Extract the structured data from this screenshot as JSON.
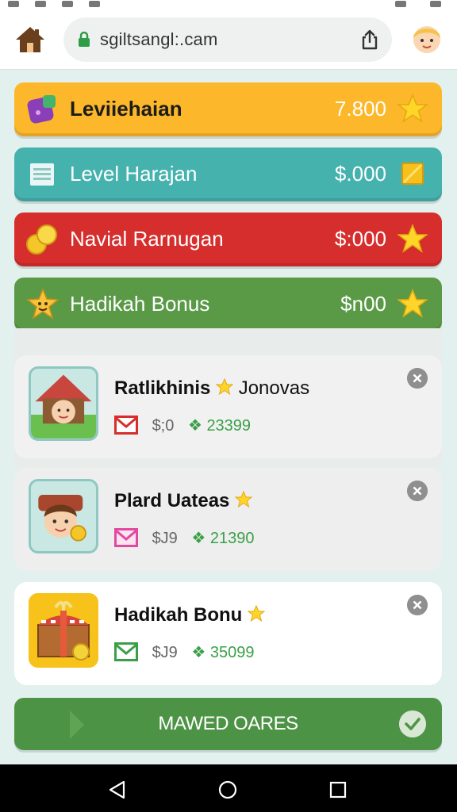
{
  "browser": {
    "url": "sgiltsangl:.cam",
    "home_icon": "home-icon",
    "lock_icon": "lock-icon",
    "share_icon": "share-icon",
    "avatar_icon": "avatar-icon"
  },
  "rewards": [
    {
      "label": "Leviiehaian",
      "value": "7.800",
      "color": "#fdb72a",
      "icon": "gem-pouch-icon",
      "end_icon": "star-icon"
    },
    {
      "label": "Level Harajan",
      "value": "$.000",
      "color": "#46b2ad",
      "icon": "document-icon",
      "end_icon": "yellow-square-icon"
    },
    {
      "label": "Navial Rarnugan",
      "value": "$:000",
      "color": "#d62e2c",
      "icon": "coins-icon",
      "end_icon": "star-icon"
    },
    {
      "label": "Hadikah Bonus",
      "value": "$n00",
      "color": "#5a9a47",
      "icon": "smiling-star-icon",
      "end_icon": "star-icon"
    }
  ],
  "cards": [
    {
      "title": "Ratlikhinis",
      "title_after": " Jonovas",
      "price": "$;0",
      "gems": "23399",
      "thumb": "house-character-icon",
      "envelope_color": "#d62e2c"
    },
    {
      "title": "Plard Uateas",
      "title_after": "",
      "price": "$J9",
      "gems": "21390",
      "thumb": "character-coin-icon",
      "envelope_color": "#e04aa0"
    },
    {
      "title": "Hadikah Bonu",
      "title_after": "",
      "price": "$J9",
      "gems": "35099",
      "thumb": "treasure-chest-icon",
      "envelope_color": "#3aa048"
    }
  ],
  "cta": {
    "label": "MAWED OARES"
  },
  "colors": {
    "accent_green": "#4d9345",
    "background": "#e3f1ee"
  },
  "nav": {
    "back": "back-icon",
    "home": "home-circle-icon",
    "recents": "recents-icon"
  }
}
